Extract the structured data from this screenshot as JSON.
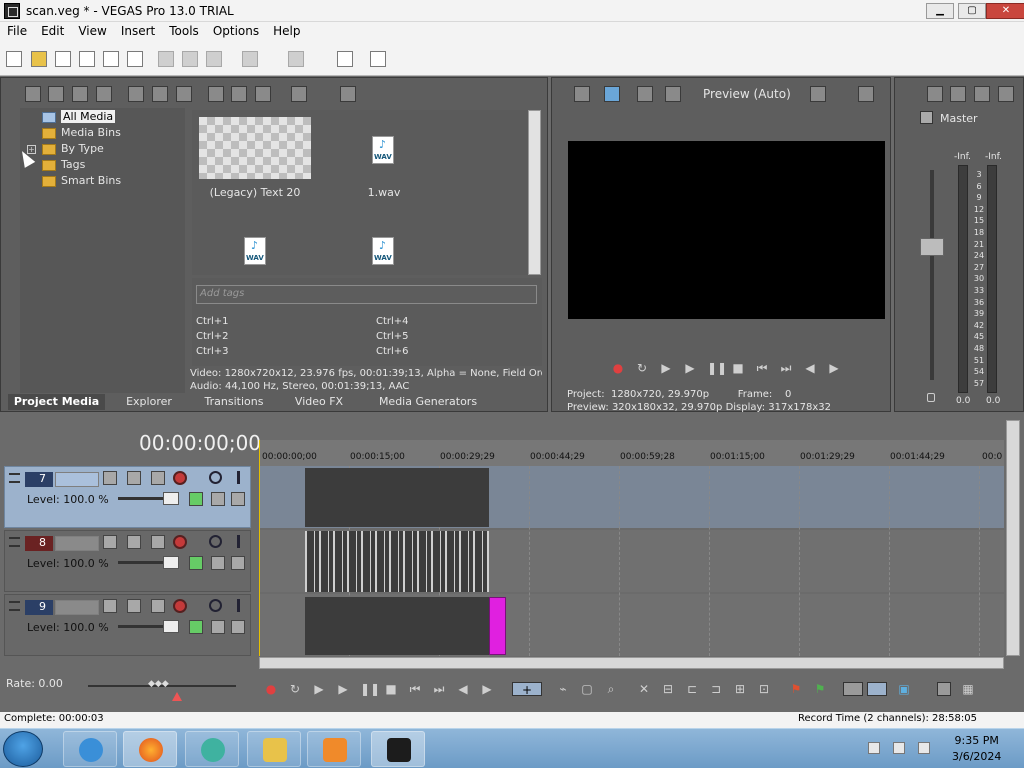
{
  "window": {
    "title": "scan.veg * - VEGAS Pro 13.0 TRIAL",
    "min_label": "▁",
    "max_label": "▢",
    "close_label": "✕"
  },
  "menu": {
    "items": [
      "File",
      "Edit",
      "View",
      "Insert",
      "Tools",
      "Options",
      "Help"
    ]
  },
  "media_tree": {
    "all_media": "All Media",
    "media_bins": "Media Bins",
    "by_type": "By Type",
    "tags": "Tags",
    "smart_bins": "Smart Bins",
    "expand": "+"
  },
  "media_items": [
    {
      "label": "(Legacy) Text 20"
    },
    {
      "label": "1.wav"
    },
    {
      "label": ""
    },
    {
      "label": ""
    }
  ],
  "wav_badge": "WAV",
  "tags": {
    "placeholder": "Add tags",
    "shortcuts": [
      "Ctrl+1",
      "Ctrl+2",
      "Ctrl+3",
      "Ctrl+4",
      "Ctrl+5",
      "Ctrl+6"
    ]
  },
  "media_info": {
    "video": "Video: 1280x720x12, 23.976 fps, 00:01:39;13, Alpha = None, Field Orde",
    "audio": "Audio: 44,100 Hz, Stereo, 00:01:39;13, AAC"
  },
  "tabs": [
    "Project Media",
    "Explorer",
    "Transitions",
    "Video FX",
    "Media Generators"
  ],
  "preview": {
    "mode": "Preview (Auto)",
    "project_label": "Project:",
    "project_value": "1280x720, 29.970p",
    "frame_label": "Frame:",
    "frame_value": "0",
    "preview_label": "Preview:",
    "preview_value": "320x180x32, 29.970p",
    "display_label": "Display:",
    "display_value": "317x178x32"
  },
  "master": {
    "label": "Master",
    "inf_left": "-Inf.",
    "inf_right": "-Inf.",
    "scale": [
      "3",
      "6",
      "9",
      "12",
      "15",
      "18",
      "21",
      "24",
      "27",
      "30",
      "33",
      "36",
      "39",
      "42",
      "45",
      "48",
      "51",
      "54",
      "57"
    ],
    "zero_left": "0.0",
    "zero_right": "0.0"
  },
  "timeline": {
    "timecode": "00:00:00;00",
    "ticks": [
      "00:00:00;00",
      "00:00:15;00",
      "00:00:29;29",
      "00:00:44;29",
      "00:00:59;28",
      "00:01:15;00",
      "00:01:29;29",
      "00:01:44;29",
      "00:0"
    ],
    "tracks": [
      {
        "number": "7",
        "level": "Level: 100.0 %"
      },
      {
        "number": "8",
        "level": "Level: 100.0 %"
      },
      {
        "number": "9",
        "level": "Level: 100.0 %"
      }
    ]
  },
  "rate": "Rate: 0.00",
  "status": {
    "complete": "Complete: 00:00:03",
    "record_time": "Record Time (2 channels): 28:58:05"
  },
  "clock": {
    "time": "9:35 PM",
    "date": "3/6/2024"
  },
  "colors": {
    "accent_selected_track": "#9cb2cc",
    "event_magenta": "#e020e0",
    "playhead": "#e6c000"
  }
}
